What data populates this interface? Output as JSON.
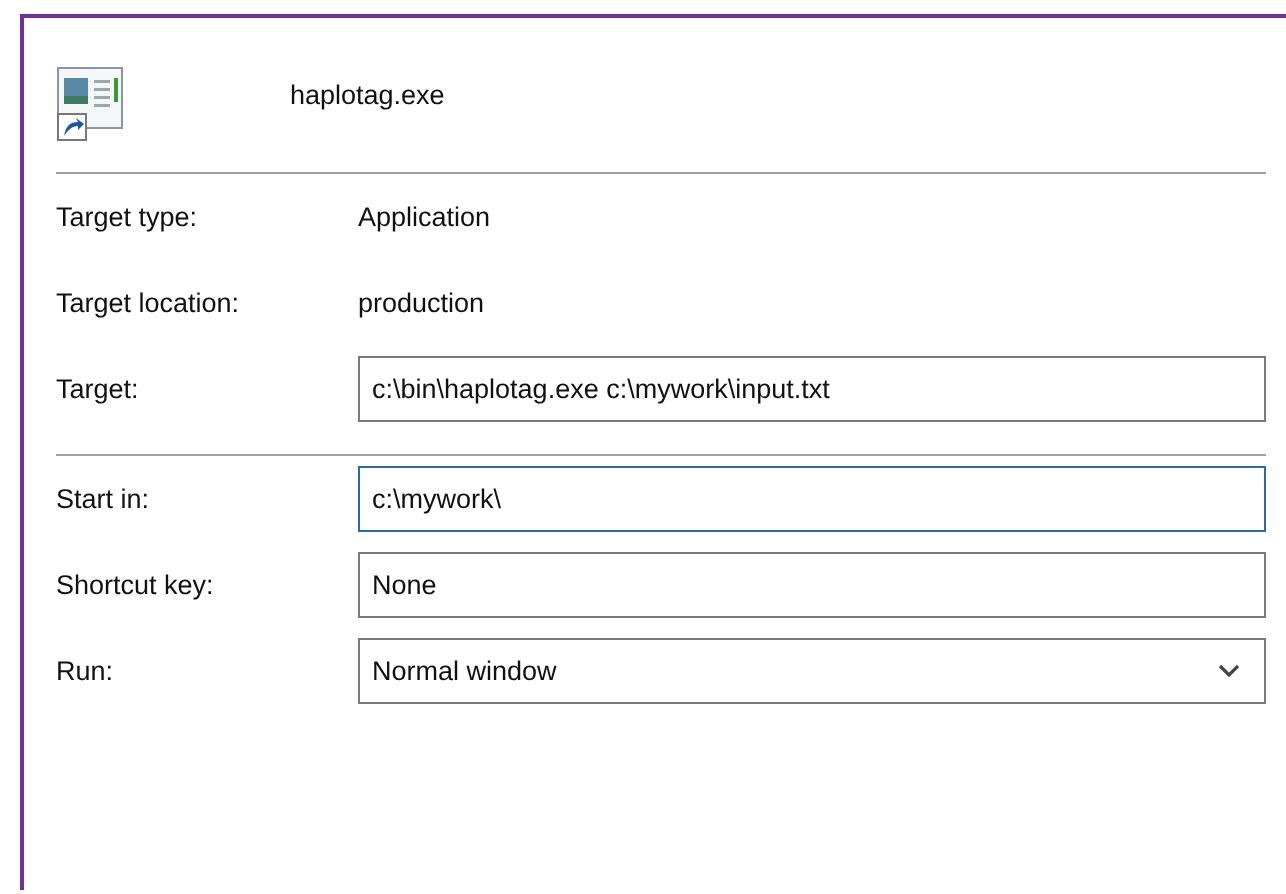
{
  "header": {
    "file_name": "haplotag.exe"
  },
  "details": [
    {
      "kind": "text",
      "label": "Target type:",
      "value": "Application"
    },
    {
      "kind": "text",
      "label": "Target location:",
      "value": "production"
    },
    {
      "kind": "input",
      "label": "Target:",
      "value": "c:\\bin\\haplotag.exe c:\\mywork\\input.txt",
      "focused": false
    }
  ],
  "settings": [
    {
      "kind": "input",
      "label": "Start in:",
      "value": "c:\\mywork\\",
      "focused": true
    },
    {
      "kind": "input",
      "label": "Shortcut key:",
      "value": "None",
      "focused": false
    },
    {
      "kind": "dropdown",
      "label": "Run:",
      "value": "Normal window",
      "focused": false
    }
  ]
}
